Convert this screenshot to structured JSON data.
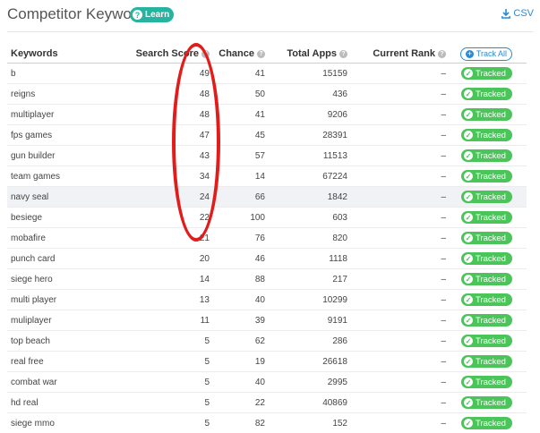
{
  "header": {
    "title": "Competitor Keywords",
    "learn_label": "Learn",
    "csv_label": "CSV"
  },
  "columns": {
    "keywords": "Keywords",
    "search_score": "Search Score",
    "chance": "Chance",
    "total_apps": "Total Apps",
    "current_rank": "Current Rank",
    "track_all": "Track All"
  },
  "rows": [
    {
      "keyword": "b",
      "score": "49",
      "chance": "41",
      "apps": "15159",
      "rank": "–",
      "status": "Tracked"
    },
    {
      "keyword": "reigns",
      "score": "48",
      "chance": "50",
      "apps": "436",
      "rank": "–",
      "status": "Tracked"
    },
    {
      "keyword": "multiplayer",
      "score": "48",
      "chance": "41",
      "apps": "9206",
      "rank": "–",
      "status": "Tracked"
    },
    {
      "keyword": "fps games",
      "score": "47",
      "chance": "45",
      "apps": "28391",
      "rank": "–",
      "status": "Tracked"
    },
    {
      "keyword": "gun builder",
      "score": "43",
      "chance": "57",
      "apps": "11513",
      "rank": "–",
      "status": "Tracked"
    },
    {
      "keyword": "team games",
      "score": "34",
      "chance": "14",
      "apps": "67224",
      "rank": "–",
      "status": "Tracked"
    },
    {
      "keyword": "navy seal",
      "score": "24",
      "chance": "66",
      "apps": "1842",
      "rank": "–",
      "status": "Tracked"
    },
    {
      "keyword": "besiege",
      "score": "22",
      "chance": "100",
      "apps": "603",
      "rank": "–",
      "status": "Tracked"
    },
    {
      "keyword": "mobafire",
      "score": "21",
      "chance": "76",
      "apps": "820",
      "rank": "–",
      "status": "Tracked"
    },
    {
      "keyword": "punch card",
      "score": "20",
      "chance": "46",
      "apps": "1118",
      "rank": "–",
      "status": "Tracked"
    },
    {
      "keyword": "siege hero",
      "score": "14",
      "chance": "88",
      "apps": "217",
      "rank": "–",
      "status": "Tracked"
    },
    {
      "keyword": "multi player",
      "score": "13",
      "chance": "40",
      "apps": "10299",
      "rank": "–",
      "status": "Tracked"
    },
    {
      "keyword": "muliplayer",
      "score": "11",
      "chance": "39",
      "apps": "9191",
      "rank": "–",
      "status": "Tracked"
    },
    {
      "keyword": "top beach",
      "score": "5",
      "chance": "62",
      "apps": "286",
      "rank": "–",
      "status": "Tracked"
    },
    {
      "keyword": "real free",
      "score": "5",
      "chance": "19",
      "apps": "26618",
      "rank": "–",
      "status": "Tracked"
    },
    {
      "keyword": "combat war",
      "score": "5",
      "chance": "40",
      "apps": "2995",
      "rank": "–",
      "status": "Tracked"
    },
    {
      "keyword": "hd real",
      "score": "5",
      "chance": "22",
      "apps": "40869",
      "rank": "–",
      "status": "Tracked"
    },
    {
      "keyword": "siege mmo",
      "score": "5",
      "chance": "82",
      "apps": "152",
      "rank": "–",
      "status": "Tracked"
    }
  ],
  "highlighted_row_index": 6,
  "icons": {
    "learn": "question-circle-icon",
    "csv": "download-icon",
    "help": "question-circle-icon",
    "track_all": "plus-circle-icon",
    "tracked": "check-circle-icon"
  },
  "colors": {
    "accent": "#2a8ad4",
    "learn_badge": "#26b3a0",
    "tracked": "#4bc55a",
    "annotation": "#e21b1b",
    "row_highlight": "#f0f2f5"
  }
}
